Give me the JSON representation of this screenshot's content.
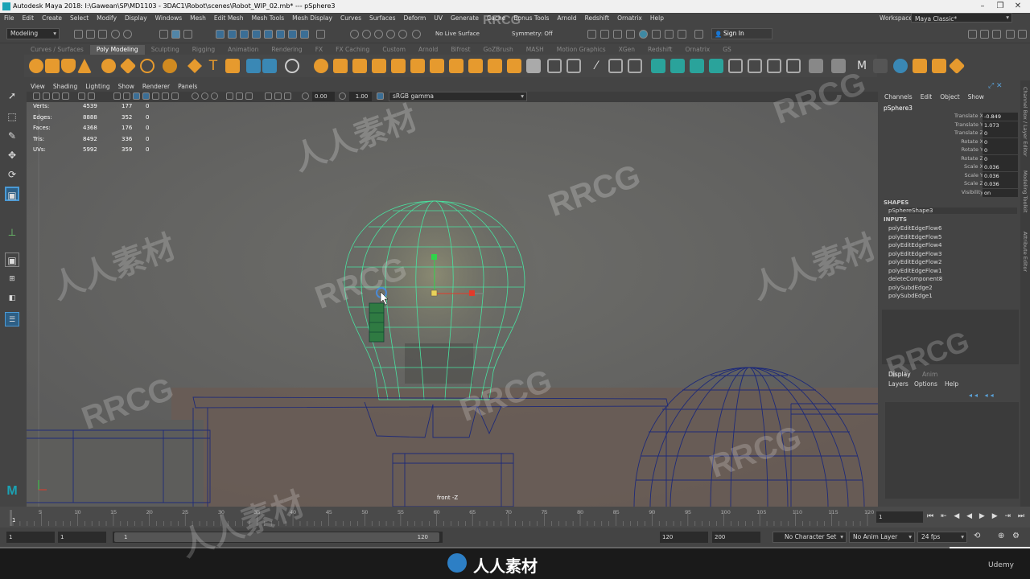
{
  "window": {
    "title": "Autodesk Maya 2018: I:\\Gawean\\SP\\MD1103 - 3DAC1\\Robot\\scenes\\Robot_WIP_02.mb*  ---  pSphere3"
  },
  "menubar": {
    "items": [
      "File",
      "Edit",
      "Create",
      "Select",
      "Modify",
      "Display",
      "Windows",
      "Mesh",
      "Edit Mesh",
      "Mesh Tools",
      "Mesh Display",
      "Curves",
      "Surfaces",
      "Deform",
      "UV",
      "Generate",
      "Cache",
      "Bonus Tools",
      "Arnold",
      "Redshift",
      "Ornatrix",
      "Help"
    ],
    "workspace_label": "Workspace :",
    "workspace_value": "Maya Classic*"
  },
  "statusline": {
    "mode": "Modeling",
    "live_surface": "No Live Surface",
    "symmetry": "Symmetry: Off",
    "sign_in": "Sign In"
  },
  "shelf": {
    "tabs": [
      "Curves / Surfaces",
      "Poly Modeling",
      "Sculpting",
      "Rigging",
      "Animation",
      "Rendering",
      "FX",
      "FX Caching",
      "Custom",
      "Arnold",
      "Bifrost",
      "GoZBrush",
      "MASH",
      "Motion Graphics",
      "XGen",
      "Redshift",
      "Ornatrix",
      "GS"
    ],
    "active_tab": "Poly Modeling"
  },
  "viewport": {
    "menu": [
      "View",
      "Shading",
      "Lighting",
      "Show",
      "Renderer",
      "Panels"
    ],
    "near_value": "0.00",
    "far_value": "1.00",
    "color_space": "sRGB gamma",
    "camera_label": "front -Z",
    "hud": [
      {
        "label": "Verts:",
        "a": "4539",
        "b": "177",
        "c": "0"
      },
      {
        "label": "Edges:",
        "a": "8888",
        "b": "352",
        "c": "0"
      },
      {
        "label": "Faces:",
        "a": "4368",
        "b": "176",
        "c": "0"
      },
      {
        "label": "Tris:",
        "a": "8492",
        "b": "336",
        "c": "0"
      },
      {
        "label": "UVs:",
        "a": "5992",
        "b": "359",
        "c": "0"
      }
    ]
  },
  "channelbox": {
    "menu": [
      "Channels",
      "Edit",
      "Object",
      "Show"
    ],
    "object": "pSphere3",
    "attributes": [
      {
        "name": "Translate X",
        "value": "-0.849"
      },
      {
        "name": "Translate Y",
        "value": "1.073"
      },
      {
        "name": "Translate Z",
        "value": "0"
      },
      {
        "name": "Rotate X",
        "value": "0"
      },
      {
        "name": "Rotate Y",
        "value": "0"
      },
      {
        "name": "Rotate Z",
        "value": "0"
      },
      {
        "name": "Scale X",
        "value": "0.036"
      },
      {
        "name": "Scale Y",
        "value": "0.036"
      },
      {
        "name": "Scale Z",
        "value": "0.036"
      },
      {
        "name": "Visibility",
        "value": "on"
      }
    ],
    "shapes_label": "SHAPES",
    "shape": "pSphereShape3",
    "inputs_label": "INPUTS",
    "inputs": [
      "polyEditEdgeFlow6",
      "polyEditEdgeFlow5",
      "polyEditEdgeFlow4",
      "polyEditEdgeFlow3",
      "polyEditEdgeFlow2",
      "polyEditEdgeFlow1",
      "deleteComponent8",
      "polySubdEdge2",
      "polySubdEdge1"
    ],
    "layer_tabs": [
      "Display",
      "Anim"
    ],
    "layer_menu": [
      "Layers",
      "Options",
      "Help"
    ]
  },
  "right_strip": [
    "Channel Box / Layer Editor",
    "Modeling Toolkit",
    "Attribute Editor"
  ],
  "timeline": {
    "ticks": [
      "1",
      "5",
      "10",
      "15",
      "20",
      "25",
      "30",
      "35",
      "40",
      "45",
      "50",
      "55",
      "60",
      "65",
      "70",
      "75",
      "80",
      "85",
      "90",
      "95",
      "100",
      "105",
      "110",
      "115",
      "120"
    ],
    "current_frame": "1"
  },
  "range": {
    "start": "1",
    "start2": "1",
    "slider_start": "1",
    "slider_end": "120",
    "end": "120",
    "end2": "200",
    "character_set": "No Character Set",
    "anim_layer": "No Anim Layer",
    "fps": "24 fps"
  },
  "watermarks": [
    "RRCG",
    "人人素材",
    "Udemy"
  ]
}
